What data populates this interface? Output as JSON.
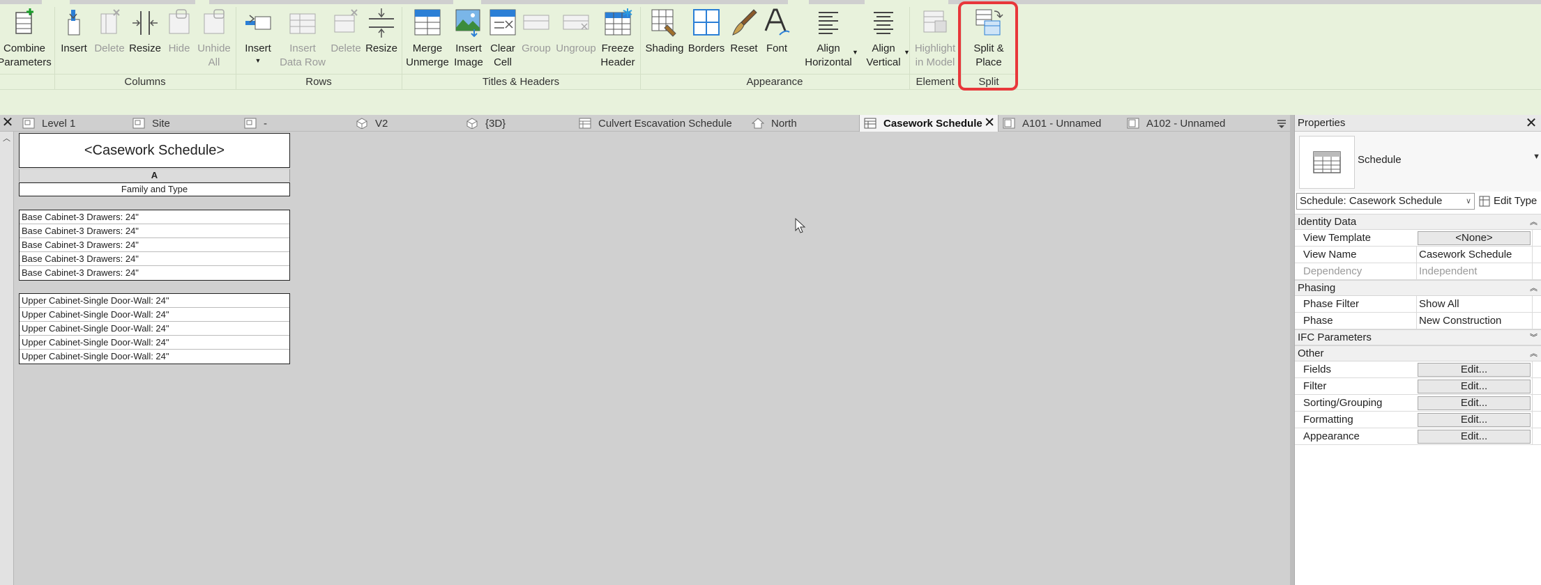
{
  "ribbon": {
    "panels": [
      {
        "label": ""
      },
      {
        "label": "Columns"
      },
      {
        "label": "Rows"
      },
      {
        "label": "Titles & Headers"
      },
      {
        "label": "Appearance"
      },
      {
        "label": "Element"
      },
      {
        "label": "Split"
      }
    ],
    "buttons": {
      "combine": "Combine\nParameters",
      "col_insert": "Insert",
      "col_delete": "Delete",
      "col_resize": "Resize",
      "col_hide": "Hide",
      "col_unhide": "Unhide\nAll",
      "row_insert": "Insert",
      "row_insert_data": "Insert\nData Row",
      "row_delete": "Delete",
      "row_resize": "Resize",
      "merge": "Merge\nUnmerge",
      "insert_image": "Insert\nImage",
      "clear_cell": "Clear\nCell",
      "group": "Group",
      "ungroup": "Ungroup",
      "freeze": "Freeze\nHeader",
      "shading": "Shading",
      "borders": "Borders",
      "reset": "Reset",
      "font": "Font",
      "align_h": "Align\nHorizontal",
      "align_v": "Align\nVertical",
      "highlight": "Highlight\nin Model",
      "split_place": "Split &\nPlace"
    }
  },
  "tabs": [
    {
      "label": "Level 1"
    },
    {
      "label": "Site"
    },
    {
      "label": "-"
    },
    {
      "label": "V2"
    },
    {
      "label": "{3D}"
    },
    {
      "label": "Culvert Escavation Schedule"
    },
    {
      "label": "North"
    },
    {
      "label": "Casework Schedule"
    },
    {
      "label": "A101 - Unnamed"
    },
    {
      "label": "A102 - Unnamed"
    }
  ],
  "schedule": {
    "title": "<Casework Schedule>",
    "column_letter": "A",
    "column_header": "Family and Type",
    "groups": [
      {
        "rows": [
          "Base Cabinet-3 Drawers: 24\"",
          "Base Cabinet-3 Drawers: 24\"",
          "Base Cabinet-3 Drawers: 24\"",
          "Base Cabinet-3 Drawers: 24\"",
          "Base Cabinet-3 Drawers: 24\""
        ]
      },
      {
        "rows": [
          "Upper Cabinet-Single Door-Wall: 24\"",
          "Upper Cabinet-Single Door-Wall: 24\"",
          "Upper Cabinet-Single Door-Wall: 24\"",
          "Upper Cabinet-Single Door-Wall: 24\"",
          "Upper Cabinet-Single Door-Wall: 24\""
        ]
      }
    ]
  },
  "properties": {
    "title": "Properties",
    "type_name": "Schedule",
    "instance_select": "Schedule: Casework Schedule",
    "edit_type": "Edit Type",
    "groups": {
      "identity": "Identity Data",
      "phasing": "Phasing",
      "ifc": "IFC Parameters",
      "other": "Other"
    },
    "rows": {
      "view_template": {
        "name": "View Template",
        "value": "<None>"
      },
      "view_name": {
        "name": "View Name",
        "value": "Casework Schedule"
      },
      "dependency": {
        "name": "Dependency",
        "value": "Independent"
      },
      "phase_filter": {
        "name": "Phase Filter",
        "value": "Show All"
      },
      "phase": {
        "name": "Phase",
        "value": "New Construction"
      },
      "fields": {
        "name": "Fields",
        "value": "Edit..."
      },
      "filter": {
        "name": "Filter",
        "value": "Edit..."
      },
      "sorting": {
        "name": "Sorting/Grouping",
        "value": "Edit..."
      },
      "formatting": {
        "name": "Formatting",
        "value": "Edit..."
      },
      "appearance": {
        "name": "Appearance",
        "value": "Edit..."
      }
    }
  },
  "colors": {
    "ribbon_bg": "#e8f2dc",
    "highlight": "#e8373a",
    "canvas_bg": "#d0d0d0"
  }
}
